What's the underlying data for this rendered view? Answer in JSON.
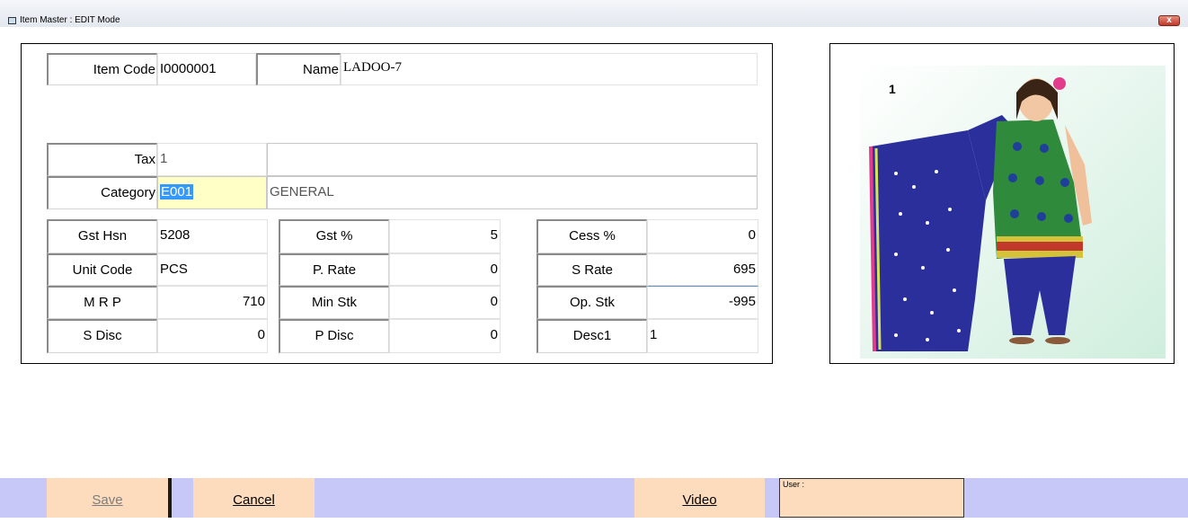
{
  "window": {
    "title": "Item Master : EDIT Mode",
    "close_glyph": "x"
  },
  "form": {
    "item_code": {
      "label": "Item Code",
      "value": "I0000001"
    },
    "name": {
      "label": "Name",
      "value": "LADOO-7"
    },
    "tax": {
      "label": "Tax",
      "value": "1",
      "description": ""
    },
    "category": {
      "label": "Category",
      "value": "E001",
      "description": "GENERAL"
    },
    "grid": [
      [
        {
          "label": "Gst Hsn",
          "value": "5208"
        },
        {
          "label": "Gst %",
          "value": "5"
        },
        {
          "label": "Cess %",
          "value": "0"
        }
      ],
      [
        {
          "label": "Unit Code",
          "value": "PCS"
        },
        {
          "label": "P. Rate",
          "value": "0"
        },
        {
          "label": "S Rate",
          "value": "695"
        }
      ],
      [
        {
          "label": "M R P",
          "value": "710"
        },
        {
          "label": "Min Stk",
          "value": "0"
        },
        {
          "label": "Op. Stk",
          "value": "-995"
        }
      ],
      [
        {
          "label": "S Disc",
          "value": "0"
        },
        {
          "label": "P Disc",
          "value": "0"
        },
        {
          "label": "Desc1",
          "value": "1"
        }
      ]
    ]
  },
  "image": {
    "label": "1",
    "subject": "woman in green and blue salwar suit with dupatta",
    "colors": {
      "background": "#e0f5e6",
      "kurta": "#2f8a3c",
      "dupatta": "#2a2f9c",
      "accent": "#e23c8c"
    }
  },
  "footer": {
    "save_label": "Save",
    "cancel_label": "Cancel",
    "video_label": "Video",
    "user_label": "User :"
  },
  "colors": {
    "footer_bg": "#c8c8f8",
    "button_bg": "#fcdcbc",
    "selection": "#3399ff",
    "category_bg": "#ffffc6"
  }
}
